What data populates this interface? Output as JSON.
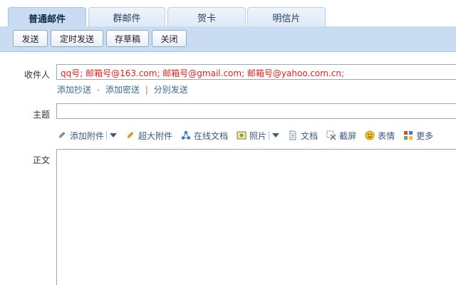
{
  "tabs": [
    {
      "label": "普通邮件",
      "active": true
    },
    {
      "label": "群邮件",
      "active": false
    },
    {
      "label": "贺卡",
      "active": false
    },
    {
      "label": "明信片",
      "active": false
    }
  ],
  "toolbar": {
    "send": "发送",
    "scheduled_send": "定时发送",
    "save_draft": "存草稿",
    "close": "关闭"
  },
  "form": {
    "to_label": "收件人",
    "to_value": "qq号; 邮箱号@163.com; 邮箱号@gmail.com; 邮箱号@yahoo.com.cn;",
    "add_cc": "添加抄送",
    "dash": "-",
    "add_bcc": "添加密送",
    "pipe": "|",
    "separate_send": "分别发送",
    "subject_label": "主题",
    "subject_value": "",
    "body_label": "正文"
  },
  "attachments": {
    "add_attachment": "添加附件",
    "large_attachment": "超大附件",
    "online_doc": "在线文档",
    "photo": "照片",
    "document": "文档",
    "screenshot": "截屏",
    "emoji": "表情",
    "more": "更多"
  },
  "colors": {
    "accent": "#c9dcf1",
    "recipient_text": "#e0241b",
    "link": "#3a6a9a"
  }
}
